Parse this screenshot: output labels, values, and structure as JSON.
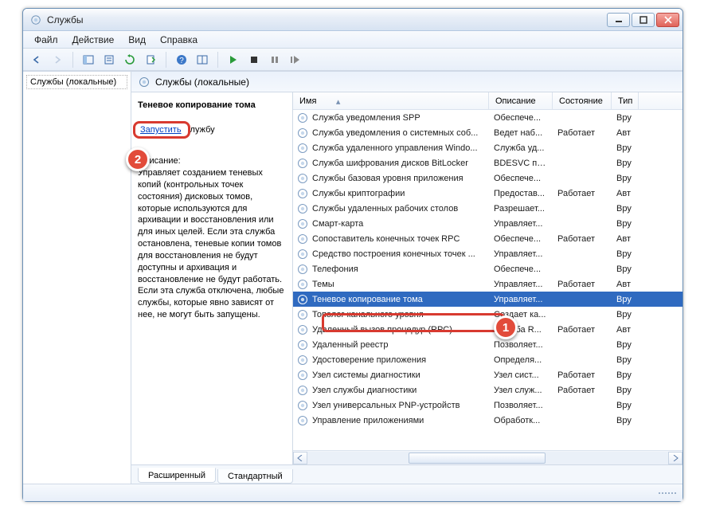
{
  "window": {
    "title": "Службы"
  },
  "menu": {
    "file": "Файл",
    "action": "Действие",
    "view": "Вид",
    "help": "Справка"
  },
  "tree": {
    "root": "Службы (локальные)"
  },
  "pane": {
    "header": "Службы (локальные)"
  },
  "detail": {
    "title": "Теневое копирование тома",
    "start_action_label": "Запустить",
    "start_suffix": "лужбу",
    "desc_label": "Описание:",
    "desc_text": "Управляет созданием теневых копий (контрольных точек состояния) дисковых томов, которые используются для архивации и восстановления или для иных целей. Если эта служба остановлена, теневые копии томов для восстановления не будут доступны и архивация и восстановление не будут работать. Если эта служба отключена, любые службы, которые явно зависят от нее, не могут быть запущены."
  },
  "columns": {
    "name": "Имя",
    "desc": "Описание",
    "state": "Состояние",
    "type": "Тип"
  },
  "services": [
    {
      "name": "Служба уведомления SPP",
      "desc": "Обеспече...",
      "state": "",
      "type": "Вру"
    },
    {
      "name": "Служба уведомления о системных соб...",
      "desc": "Ведет наб...",
      "state": "Работает",
      "type": "Авт"
    },
    {
      "name": "Служба удаленного управления Windo...",
      "desc": "Служба уд...",
      "state": "",
      "type": "Вру"
    },
    {
      "name": "Служба шифрования дисков BitLocker",
      "desc": "BDESVC пр...",
      "state": "",
      "type": "Вру"
    },
    {
      "name": "Службы базовая уровня приложения",
      "desc": "Обеспече...",
      "state": "",
      "type": "Вру"
    },
    {
      "name": "Службы криптографии",
      "desc": "Предостав...",
      "state": "Работает",
      "type": "Авт"
    },
    {
      "name": "Службы удаленных рабочих столов",
      "desc": "Разрешает...",
      "state": "",
      "type": "Вру"
    },
    {
      "name": "Смарт-карта",
      "desc": "Управляет...",
      "state": "",
      "type": "Вру"
    },
    {
      "name": "Сопоставитель конечных точек RPC",
      "desc": "Обеспече...",
      "state": "Работает",
      "type": "Авт"
    },
    {
      "name": "Средство построения конечных точек ...",
      "desc": "Управляет...",
      "state": "",
      "type": "Вру"
    },
    {
      "name": "Телефония",
      "desc": "Обеспече...",
      "state": "",
      "type": "Вру"
    },
    {
      "name": "Темы",
      "desc": "Управляет...",
      "state": "Работает",
      "type": "Авт"
    },
    {
      "name": "Теневое копирование тома",
      "desc": "Управляет...",
      "state": "",
      "type": "Вру",
      "selected": true
    },
    {
      "name": "Тополог канального уровня",
      "desc": "Создает ка...",
      "state": "",
      "type": "Вру"
    },
    {
      "name": "Удаленный вызов процедур (RPC)",
      "desc": "Служба R...",
      "state": "Работает",
      "type": "Авт"
    },
    {
      "name": "Удаленный реестр",
      "desc": "Позволяет...",
      "state": "",
      "type": "Вру"
    },
    {
      "name": "Удостоверение приложения",
      "desc": "Определя...",
      "state": "",
      "type": "Вру"
    },
    {
      "name": "Узел системы диагностики",
      "desc": "Узел сист...",
      "state": "Работает",
      "type": "Вру"
    },
    {
      "name": "Узел службы диагностики",
      "desc": "Узел служ...",
      "state": "Работает",
      "type": "Вру"
    },
    {
      "name": "Узел универсальных PNP-устройств",
      "desc": "Позволяет...",
      "state": "",
      "type": "Вру"
    },
    {
      "name": "Управление приложениями",
      "desc": "Обработк...",
      "state": "",
      "type": "Вру"
    }
  ],
  "tabs": {
    "ext": "Расширенный",
    "std": "Стандартный"
  },
  "callouts": {
    "one": "1",
    "two": "2"
  },
  "sort_indicator": "▴"
}
